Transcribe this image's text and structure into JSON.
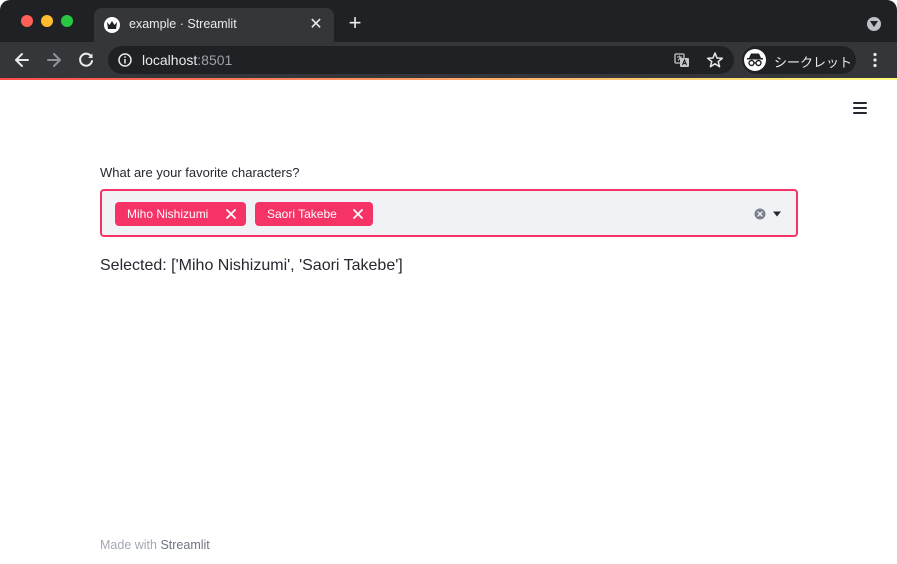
{
  "browser": {
    "tab_title": "example · Streamlit",
    "tab_close_glyph": "✕",
    "new_tab_glyph": "+",
    "url_host": "localhost",
    "url_port": ":8501",
    "incognito_label": "シークレット",
    "icons": [
      "streamlit-crown-icon",
      "close-icon",
      "plus-icon",
      "tab-search-icon",
      "back-arrow-icon",
      "forward-arrow-icon",
      "reload-icon",
      "info-icon",
      "translate-icon",
      "star-icon",
      "incognito-icon",
      "kebab-menu-icon"
    ],
    "colors": {
      "frame": "#202124",
      "toolbar": "#35363a"
    }
  },
  "app": {
    "multiselect": {
      "label": "What are your favorite characters?",
      "selected": [
        "Miho Nishizumi",
        "Saori Takebe"
      ]
    },
    "output_text": "Selected: ['Miho Nishizumi', 'Saori Takebe']",
    "footer": {
      "prefix": "Made with ",
      "brand": "Streamlit"
    },
    "colors": {
      "accent": "#f63366",
      "input_bg": "#f0f2f6",
      "text": "#262730"
    }
  }
}
